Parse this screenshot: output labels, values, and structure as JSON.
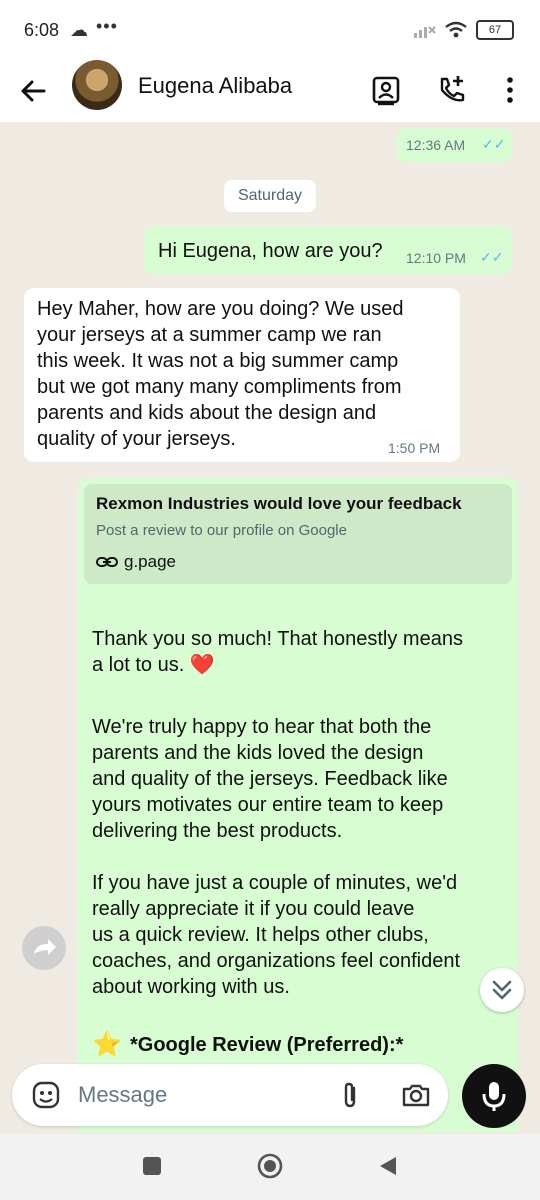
{
  "status_bar": {
    "time": "6:08",
    "extra": "•••",
    "battery": "67"
  },
  "header": {
    "contact_name": "Eugena Alibaba"
  },
  "chat": {
    "top_message_time": "12:36 AM",
    "day_divider": "Saturday",
    "out_1_text": "Hi Eugena, how are you?",
    "out_1_time": "12:10 PM",
    "in_1_text": "Hey Maher, how are you doing? We used\nyour jerseys at a summer camp we ran\nthis week. It was not a big summer camp\nbut we got many many compliments from\nparents and kids about the design and\nquality of your jerseys.",
    "in_1_time": "1:50 PM",
    "link_preview": {
      "title": "Rexmon Industries would love your feedback",
      "description": "Post a review to our profile on Google",
      "domain": "g.page"
    },
    "out_2_para_1": "Thank you so much! That honestly means\na lot to us. ❤️",
    "out_2_para_2": "We're truly happy to hear that both the\nparents and the kids loved the design\nand quality of the jerseys. Feedback like\nyours motivates our entire team to keep\ndelivering the best products.",
    "out_2_para_3": "If you have just a couple of minutes, we'd\nreally appreciate it if you could leave\nus a quick review. It helps other clubs,\ncoaches, and organizations feel confident\nabout working with us.",
    "out_2_star": "⭐",
    "out_2_heading": "*Google Review (Preferred):*"
  },
  "composer": {
    "placeholder": "Message"
  },
  "colors": {
    "outgoing_bubble": "#d9fdd3",
    "incoming_bubble": "#ffffff",
    "read_ticks": "#53bdeb",
    "chat_background": "#efeae2"
  },
  "icons": [
    "back-arrow-icon",
    "contact-card-icon",
    "add-call-icon",
    "more-vert-icon",
    "emoji-icon",
    "attach-icon",
    "camera-icon",
    "mic-icon",
    "forward-icon",
    "chevron-double-down-icon",
    "link-icon",
    "nav-square-icon",
    "nav-home-icon",
    "nav-back-icon"
  ]
}
